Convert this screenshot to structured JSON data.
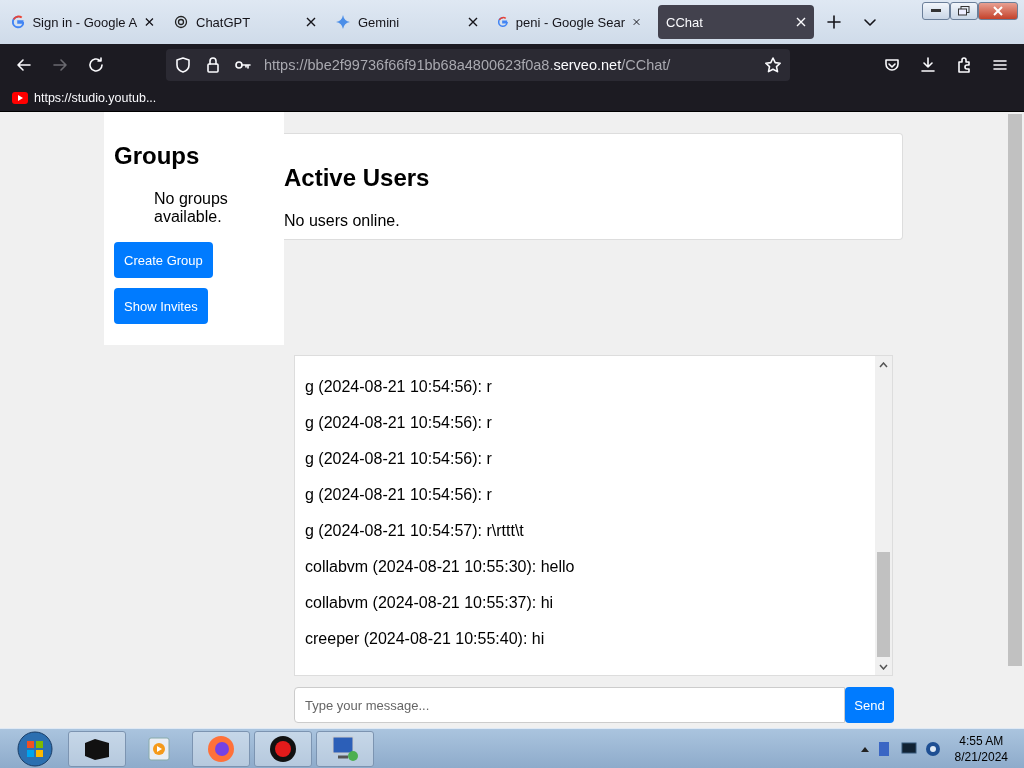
{
  "browser": {
    "tabs": [
      {
        "title": "Sign in - Google A",
        "kind": "google",
        "selected": false
      },
      {
        "title": "ChatGPT",
        "kind": "knot",
        "selected": false
      },
      {
        "title": "Gemini",
        "kind": "sparkle",
        "selected": false
      },
      {
        "title": "peni - Google Sear",
        "kind": "google",
        "selected": false
      },
      {
        "title": "CChat",
        "kind": "none",
        "selected": true
      }
    ],
    "url_prefix": "https://bbe2f99736f66f91bb68a4800623f0a8.",
    "url_domain": "serveo.net",
    "url_path": "/CChat/",
    "bookmarks": [
      {
        "title": "https://studio.youtub..."
      }
    ]
  },
  "groups": {
    "title": "Groups",
    "empty_text": "No groups available.",
    "buttons": [
      "Create Group",
      "Show Invites"
    ]
  },
  "active_users": {
    "title": "Active Users",
    "empty_text": "No users online."
  },
  "messages": [
    {
      "text": "g (2024-08-21 10:54:56): r"
    },
    {
      "text": "g (2024-08-21 10:54:56): r"
    },
    {
      "text": "g (2024-08-21 10:54:56): r"
    },
    {
      "text": "g (2024-08-21 10:54:56): r"
    },
    {
      "text": "g (2024-08-21 10:54:57): r\\rttt\\t"
    },
    {
      "text": "collabvm (2024-08-21 10:55:30): hello"
    },
    {
      "text": "collabvm (2024-08-21 10:55:37): hi"
    },
    {
      "text": "creeper (2024-08-21 10:55:40): hi"
    }
  ],
  "composer": {
    "placeholder": "Type your message...",
    "send": "Send"
  },
  "taskbar": {
    "time": "4:55 AM",
    "date": "8/21/2024"
  }
}
